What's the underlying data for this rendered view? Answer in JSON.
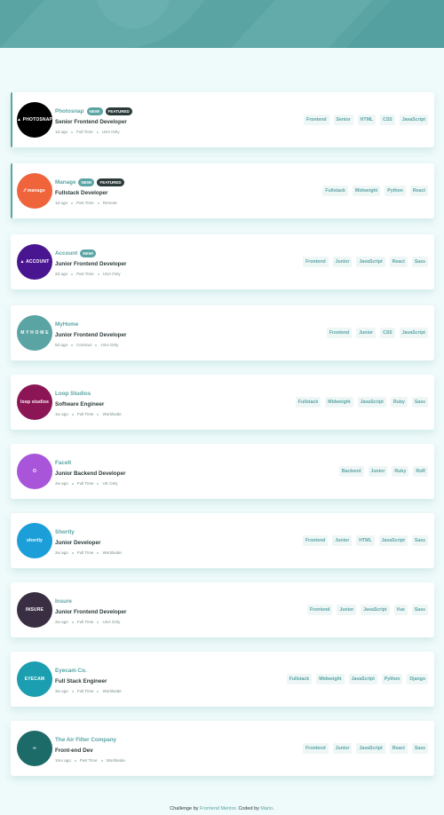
{
  "colors": {
    "primary": "#5ba4a4",
    "background": "#effafa",
    "dark": "#2c3a3a",
    "muted": "#7b8e8e"
  },
  "jobs": [
    {
      "company": "Photosnap",
      "logo_text": "▲ PHOTOSNAP",
      "logo_color": "#000000",
      "new": "NEW!",
      "featured": "FEATURED",
      "position": "Senior Frontend Developer",
      "posted": "1d ago",
      "contract": "Full Time",
      "location": "USA Only",
      "tags": [
        "Frontend",
        "Senior",
        "HTML",
        "CSS",
        "JavaScript"
      ]
    },
    {
      "company": "Manage",
      "logo_text": "⁄⁄ manage",
      "logo_color": "#f0643c",
      "new": "NEW!",
      "featured": "FEATURED",
      "position": "Fullstack Developer",
      "posted": "1d ago",
      "contract": "Part Time",
      "location": "Remote",
      "tags": [
        "Fullstack",
        "Midweight",
        "Python",
        "React"
      ]
    },
    {
      "company": "Account",
      "logo_text": "▲ ACCOUNT",
      "logo_color": "#4a1590",
      "new": "NEW!",
      "featured": "",
      "position": "Junior Frontend Developer",
      "posted": "2d ago",
      "contract": "Part Time",
      "location": "USA Only",
      "tags": [
        "Frontend",
        "Junior",
        "JavaScript",
        "React",
        "Sass"
      ]
    },
    {
      "company": "MyHome",
      "logo_text": "M Y H O M E",
      "logo_color": "#5ba4a4",
      "new": "",
      "featured": "",
      "position": "Junior Frontend Developer",
      "posted": "5d ago",
      "contract": "Contract",
      "location": "USA Only",
      "tags": [
        "Frontend",
        "Junior",
        "CSS",
        "JavaScript"
      ]
    },
    {
      "company": "Loop Studios",
      "logo_text": "loop studios",
      "logo_color": "#8c1655",
      "new": "",
      "featured": "",
      "position": "Software Engineer",
      "posted": "1w ago",
      "contract": "Full Time",
      "location": "Worldwide",
      "tags": [
        "Fullstack",
        "Midweight",
        "JavaScript",
        "Ruby",
        "Sass"
      ]
    },
    {
      "company": "FaceIt",
      "logo_text": "O",
      "logo_color": "#a855d9",
      "new": "",
      "featured": "",
      "position": "Junior Backend Developer",
      "posted": "2w ago",
      "contract": "Full Time",
      "location": "UK Only",
      "tags": [
        "Backend",
        "Junior",
        "Ruby",
        "RoR"
      ]
    },
    {
      "company": "Shortly",
      "logo_text": "shortly",
      "logo_color": "#1c9fd9",
      "new": "",
      "featured": "",
      "position": "Junior Developer",
      "posted": "2w ago",
      "contract": "Full Time",
      "location": "Worldwide",
      "tags": [
        "Frontend",
        "Junior",
        "HTML",
        "JavaScript",
        "Sass"
      ]
    },
    {
      "company": "Insure",
      "logo_text": "INSURE",
      "logo_color": "#3a2f42",
      "new": "",
      "featured": "",
      "position": "Junior Frontend Developer",
      "posted": "2w ago",
      "contract": "Full Time",
      "location": "USA Only",
      "tags": [
        "Frontend",
        "Junior",
        "JavaScript",
        "Vue",
        "Sass"
      ]
    },
    {
      "company": "Eyecam Co.",
      "logo_text": "EYECAM",
      "logo_color": "#1b9eb0",
      "new": "",
      "featured": "",
      "position": "Full Stack Engineer",
      "posted": "3w ago",
      "contract": "Full Time",
      "location": "Worldwide",
      "tags": [
        "Fullstack",
        "Midweight",
        "JavaScript",
        "Python",
        "Django"
      ]
    },
    {
      "company": "The Air Filter Company",
      "logo_text": "∞",
      "logo_color": "#1d6b68",
      "new": "",
      "featured": "",
      "position": "Front-end Dev",
      "posted": "1mo ago",
      "contract": "Part Time",
      "location": "Worldwide",
      "tags": [
        "Frontend",
        "Junior",
        "JavaScript",
        "React",
        "Sass"
      ]
    }
  ],
  "footer": {
    "prefix": "Challenge by ",
    "link1": "Frontend Mentor",
    "middle": ". Coded by ",
    "link2": "Mario",
    "suffix": "."
  }
}
